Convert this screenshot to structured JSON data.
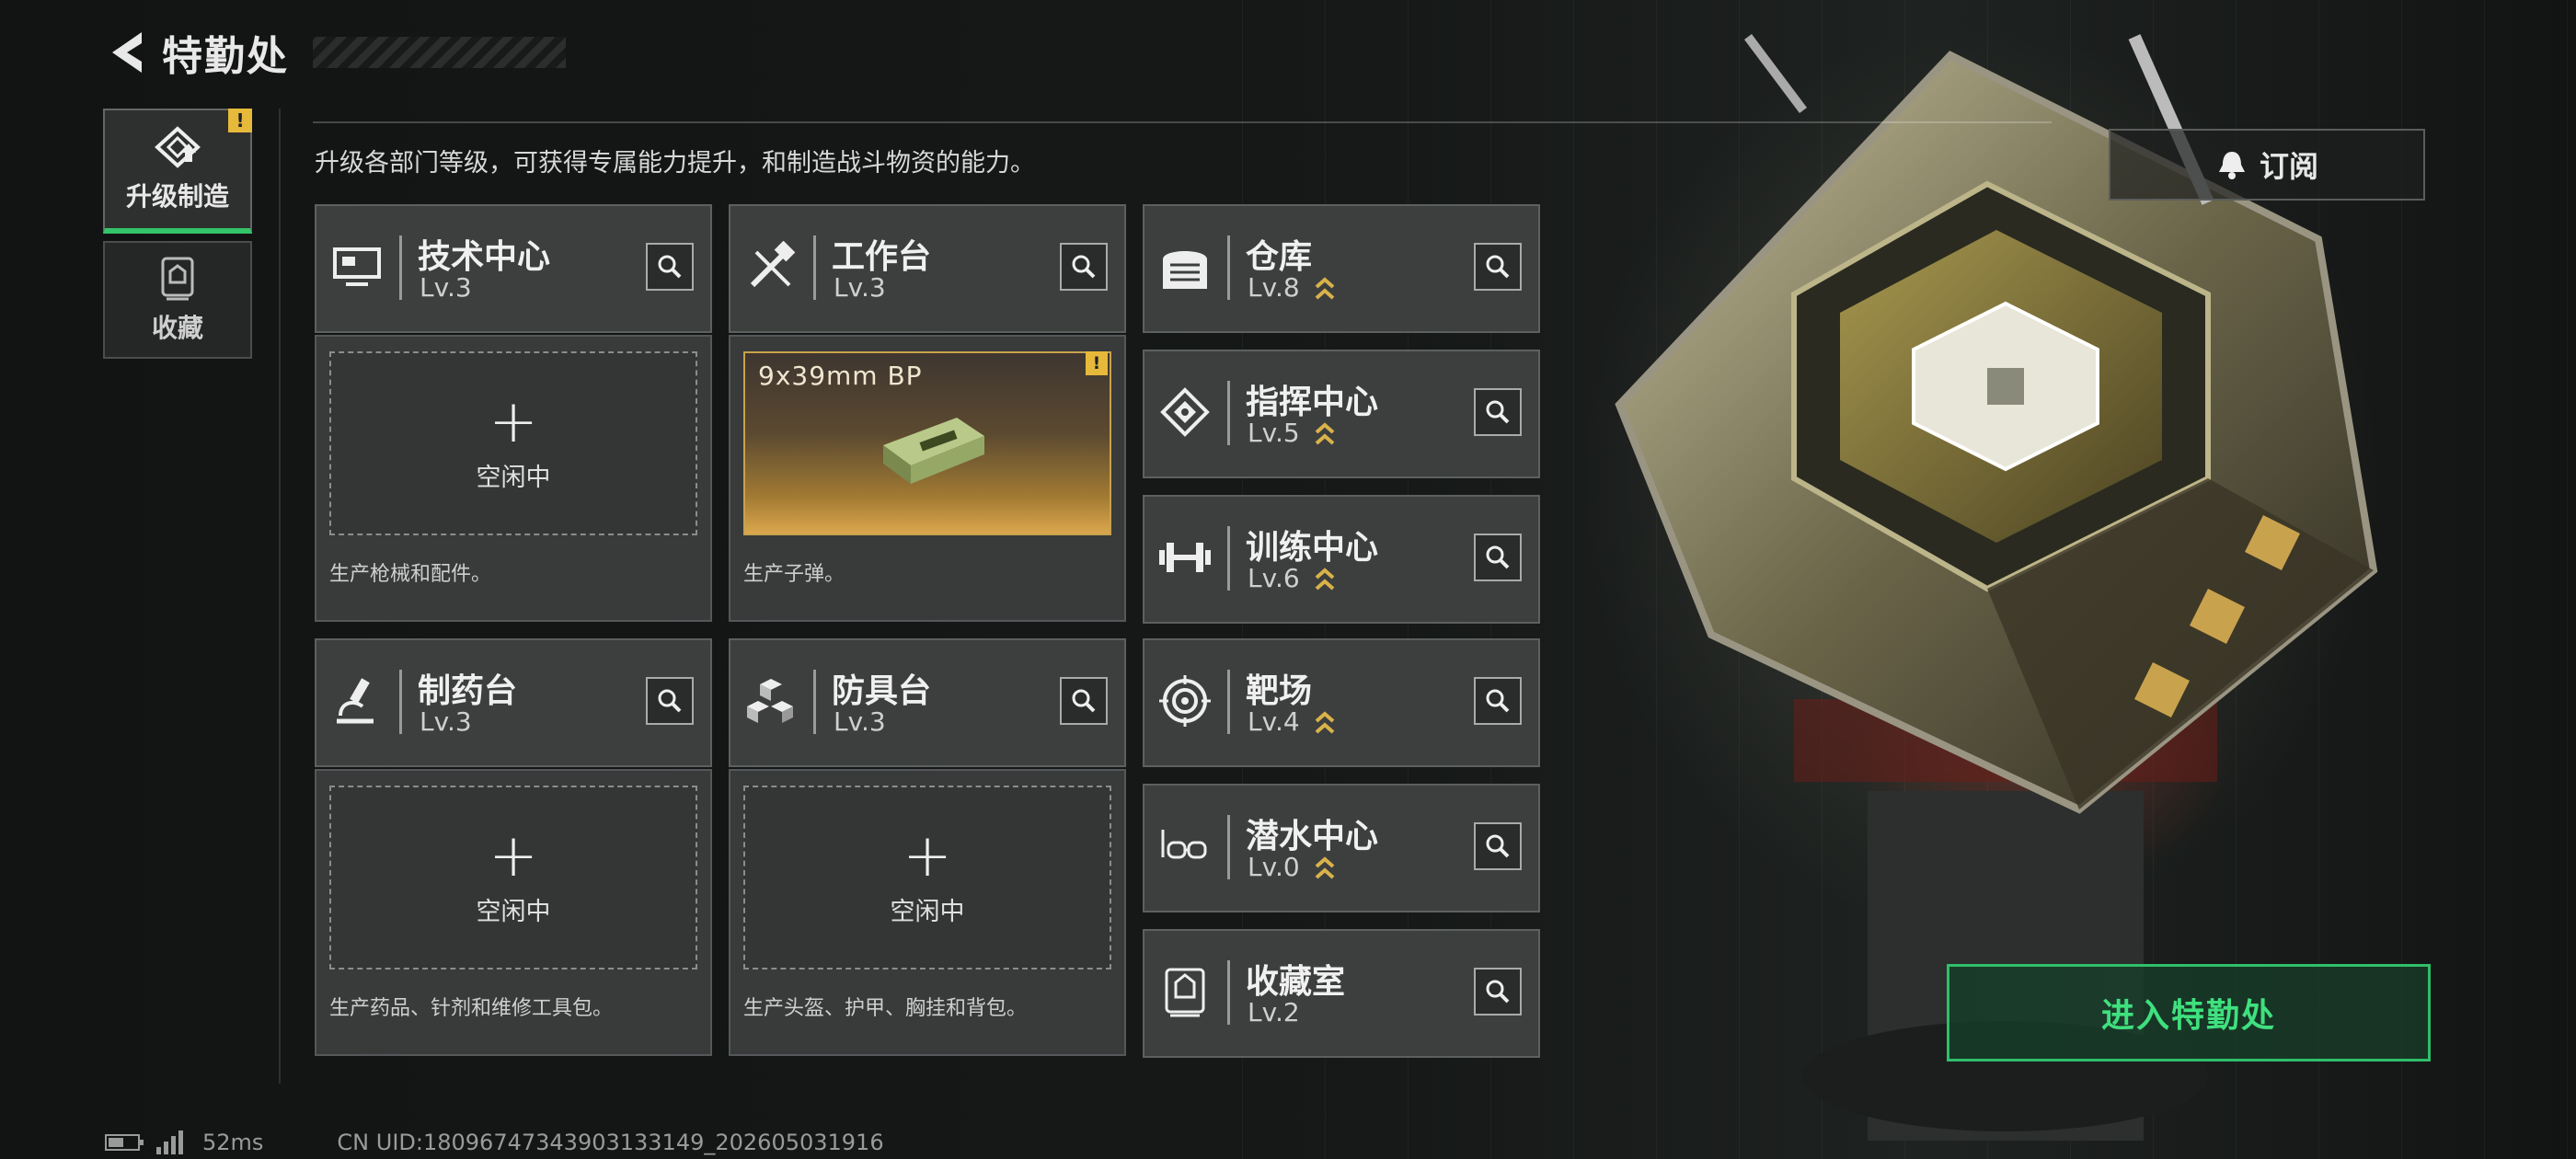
{
  "header": {
    "title": "特勤处"
  },
  "nav": {
    "tabs": [
      {
        "label": "升级制造",
        "active": true,
        "alert": "!"
      },
      {
        "label": "收藏",
        "active": false
      }
    ]
  },
  "subtitle": "升级各部门等级，可获得专属能力提升，和制造战斗物资的能力。",
  "subscribe": {
    "label": "订阅",
    "icon": "bell-icon"
  },
  "facilities": [
    {
      "name": "技术中心",
      "level": "Lv.3",
      "icon": "monitor-icon",
      "upgradable": false
    },
    {
      "name": "工作台",
      "level": "Lv.3",
      "icon": "tools-icon",
      "upgradable": false
    },
    {
      "name": "仓库",
      "level": "Lv.8",
      "icon": "warehouse-icon",
      "upgradable": true
    },
    {
      "name": "指挥中心",
      "level": "Lv.5",
      "icon": "chip-icon",
      "upgradable": true
    },
    {
      "name": "训练中心",
      "level": "Lv.6",
      "icon": "dumbbell-icon",
      "upgradable": true
    },
    {
      "name": "制药台",
      "level": "Lv.3",
      "icon": "microscope-icon",
      "upgradable": false
    },
    {
      "name": "防具台",
      "level": "Lv.3",
      "icon": "cubes-icon",
      "upgradable": false
    },
    {
      "name": "靶场",
      "level": "Lv.4",
      "icon": "target-icon",
      "upgradable": true
    },
    {
      "name": "潜水中心",
      "level": "Lv.0",
      "icon": "diving-mask-icon",
      "upgradable": true
    },
    {
      "name": "收藏室",
      "level": "Lv.2",
      "icon": "trophy-icon",
      "upgradable": false
    }
  ],
  "production": {
    "tech": {
      "status": "空闲中",
      "desc": "生产枪械和配件。"
    },
    "workbench": {
      "item": "9x39mm BP",
      "alert": "!",
      "desc": "生产子弹。"
    },
    "pharmacy": {
      "status": "空闲中",
      "desc": "生产药品、针剂和维修工具包。"
    },
    "armor": {
      "status": "空闲中",
      "desc": "生产头盔、护甲、胸挂和背包。"
    }
  },
  "enter_button": {
    "label": "进入特勤处"
  },
  "status_bar": {
    "ping": "52ms",
    "uid": "CN UID:18096747343903133149_202605031916"
  },
  "colors": {
    "accent_green": "#34c46a",
    "alert_yellow": "#e6b93b",
    "upgrade_gold": "#d9b24a"
  }
}
